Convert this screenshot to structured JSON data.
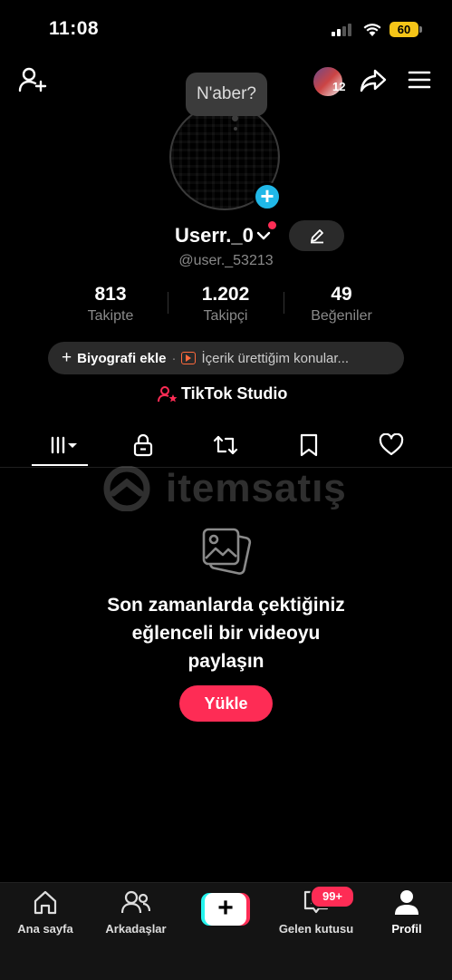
{
  "status_bar": {
    "time": "11:08",
    "battery": "60"
  },
  "header": {
    "story_count": "12"
  },
  "profile": {
    "bubble_text": "N'aber?",
    "username": "Userr._0",
    "handle": "@user._53213"
  },
  "stats": [
    {
      "value": "813",
      "label": "Takipte"
    },
    {
      "value": "1.202",
      "label": "Takipçi"
    },
    {
      "value": "49",
      "label": "Beğeniler"
    }
  ],
  "bio": {
    "add_label": "Biyografi ekle",
    "separator": "·",
    "topics": "İçerik ürettiğim konular..."
  },
  "studio_label": "TikTok Studio",
  "watermark": "itemsatış",
  "empty_state": {
    "line1": "Son zamanlarda çektiğiniz",
    "line2": "eğlenceli bir videoyu",
    "line3": "paylaşın",
    "button": "Yükle"
  },
  "bottom_nav": {
    "home": "Ana sayfa",
    "friends": "Arkadaşlar",
    "inbox": "Gelen kutusu",
    "inbox_badge": "99+",
    "profile": "Profil"
  },
  "colors": {
    "accent": "#fe2c55",
    "cyan": "#25f4ee",
    "badge_blue": "#20b8e8"
  },
  "icons": [
    "add-user-icon",
    "share-icon",
    "menu-icon",
    "videos-grid-icon",
    "lock-icon",
    "repost-icon",
    "bookmark-icon",
    "heart-icon",
    "photo-icon",
    "home-icon",
    "friends-icon",
    "inbox-icon",
    "profile-icon",
    "pencil-icon",
    "studio-icon"
  ]
}
